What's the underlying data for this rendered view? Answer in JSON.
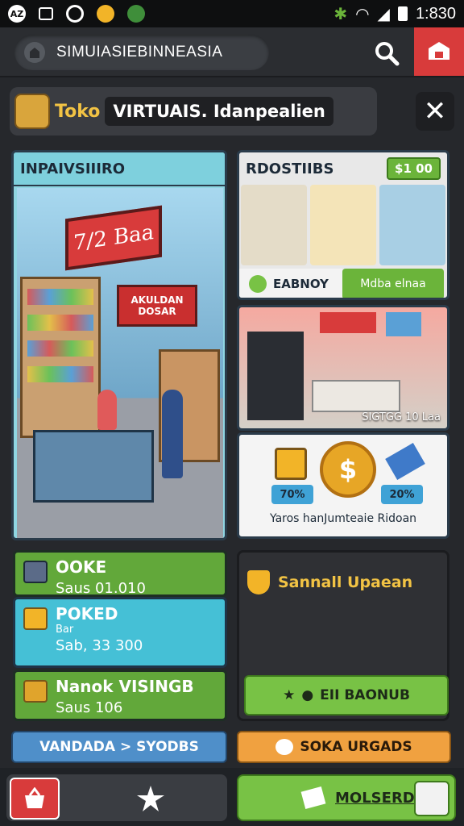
{
  "status": {
    "time": "1:830"
  },
  "search": {
    "value": "SIMUIASIEBINNEASIA"
  },
  "header": {
    "prefix": "Toko",
    "title": "VIRTUAIS. Idanpealien"
  },
  "left_panel": {
    "title": "INPAIVSIIIRO",
    "sign_main": "7/2 Baa",
    "sign_sub": "AKULDAN DOSAR"
  },
  "products": {
    "title": "RDOSTIIBS",
    "price": "$1 00",
    "label": "EABNOY",
    "button": "Mdba elnaa"
  },
  "store_scene": {
    "caption": "SIGTGG 10 Laa"
  },
  "reward": {
    "coin": "$",
    "left_pct": "70%",
    "right_pct": "20%",
    "text": "Yaros hanJumteaie Ridoan"
  },
  "stats": [
    {
      "name": "OOKE",
      "sub": "Saus 01.010"
    },
    {
      "name": "POKED",
      "sub2": "Bar",
      "sub": "Sab, 33 300"
    },
    {
      "name": "Nanok VISINGB",
      "sub": "Saus 106"
    }
  ],
  "side_box": {
    "title": "Sannall Upaean",
    "button": "EII BAONUB"
  },
  "pills": {
    "left": "VANDADA > SYODBS",
    "right": "SOKA URGADS"
  },
  "bottom": {
    "right_label": "MOLSERD"
  },
  "colors": {
    "accent_green": "#78c245",
    "accent_red": "#d83b3b",
    "accent_orange": "#f0a140",
    "accent_blue": "#4f8fc9"
  }
}
